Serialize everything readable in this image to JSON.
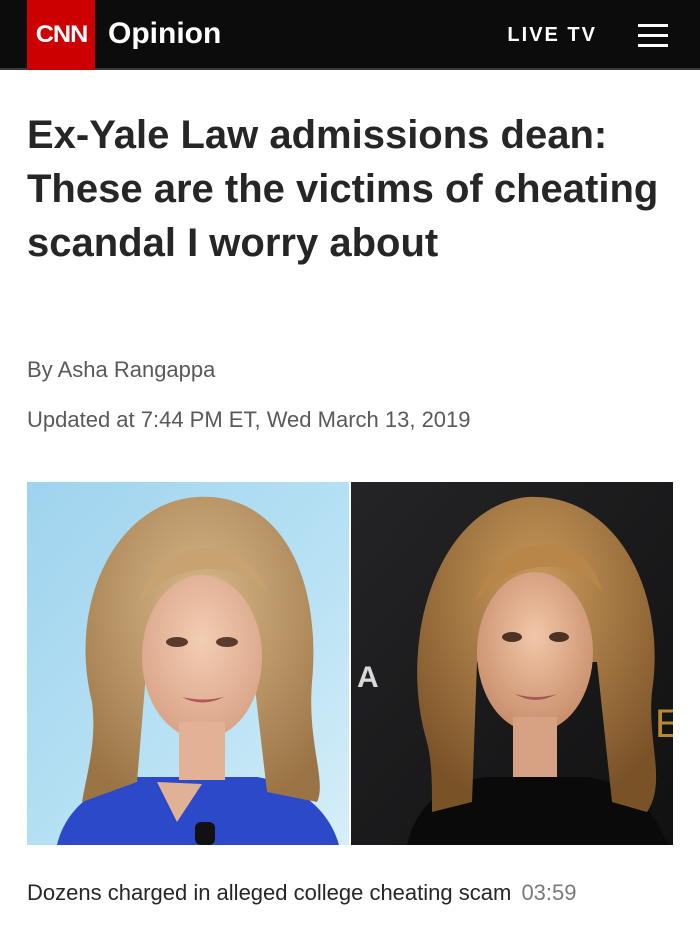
{
  "header": {
    "logo_text": "CNN",
    "section": "Opinion",
    "live_tv_label": "LIVE TV",
    "menu_icon": "hamburger-menu-icon",
    "brand_color": "#cc0000"
  },
  "article": {
    "headline": "Ex-Yale Law admissions dean: These are the victims of cheating scandal I worry about",
    "byline": "By Asha Rangappa",
    "updated": "Updated at 7:44 PM ET, Wed March 13, 2019"
  },
  "video": {
    "caption": "Dozens charged in alleged college cheating scam",
    "duration": "03:59"
  }
}
